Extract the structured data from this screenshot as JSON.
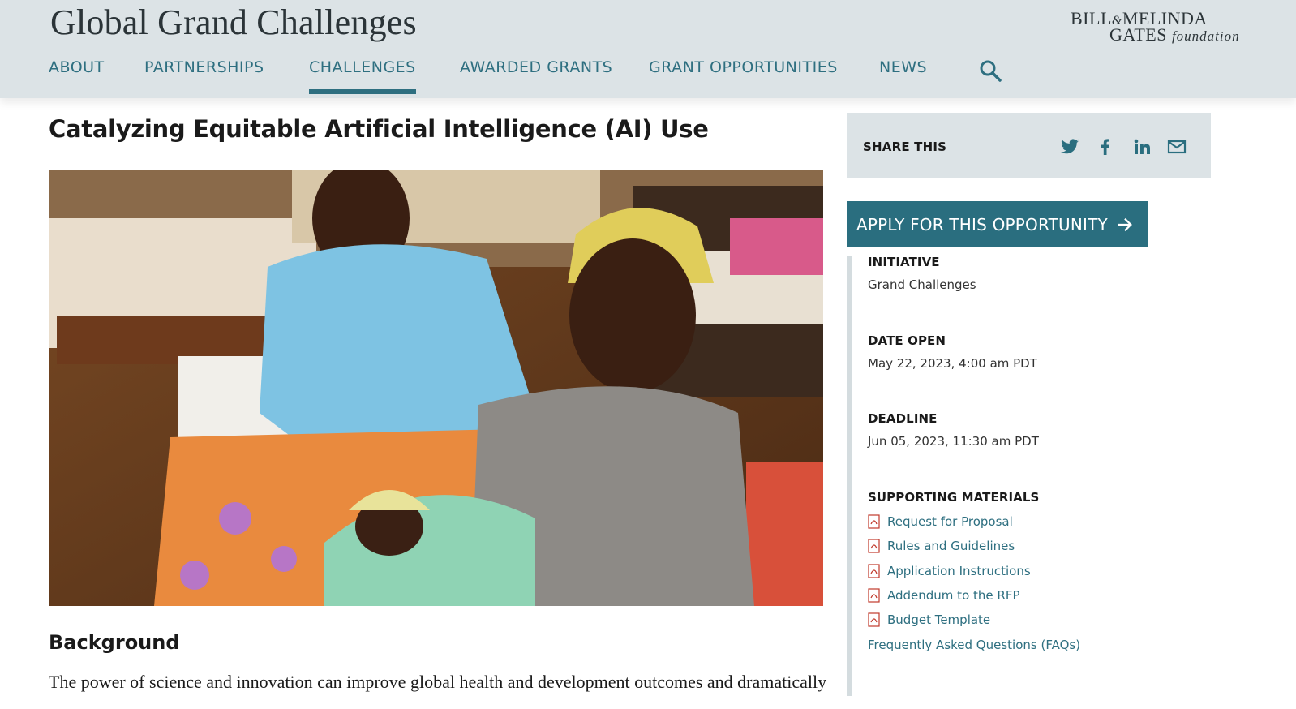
{
  "header": {
    "site_title": "Global Grand Challenges",
    "logo": {
      "line1_a": "BILL",
      "line1_amp": "&",
      "line1_b": "MELINDA",
      "line2": "GATES",
      "line2_suffix": "foundation"
    },
    "nav": [
      {
        "label": "ABOUT",
        "active": false
      },
      {
        "label": "PARTNERSHIPS",
        "active": false
      },
      {
        "label": "CHALLENGES",
        "active": true
      },
      {
        "label": "AWARDED GRANTS",
        "active": false
      },
      {
        "label": "GRANT OPPORTUNITIES",
        "active": false
      },
      {
        "label": "NEWS",
        "active": false
      }
    ],
    "search_icon": "search-icon"
  },
  "main": {
    "title": "Catalyzing Equitable Artificial Intelligence (AI) Use",
    "background_heading": "Background",
    "body_first_line": "The power of science and innovation can improve global health and development outcomes and dramatically"
  },
  "sidebar": {
    "share_label": "SHARE THIS",
    "share_icons": [
      "twitter-icon",
      "facebook-icon",
      "linkedin-icon",
      "email-icon"
    ],
    "apply_label": "APPLY FOR THIS OPPORTUNITY",
    "initiative": {
      "label": "INITIATIVE",
      "value": "Grand Challenges"
    },
    "date_open": {
      "label": "DATE OPEN",
      "value": "May 22, 2023, 4:00 am PDT"
    },
    "deadline": {
      "label": "DEADLINE",
      "value": "Jun 05, 2023, 11:30 am PDT"
    },
    "materials": {
      "label": "SUPPORTING MATERIALS",
      "links": [
        {
          "label": "Request for Proposal",
          "pdf": true
        },
        {
          "label": "Rules and Guidelines",
          "pdf": true
        },
        {
          "label": "Application Instructions",
          "pdf": true
        },
        {
          "label": "Addendum to the RFP",
          "pdf": true
        },
        {
          "label": "Budget Template",
          "pdf": true
        },
        {
          "label": "Frequently Asked Questions (FAQs)",
          "pdf": false
        }
      ]
    }
  },
  "colors": {
    "accent": "#2a6e7f",
    "nav_text": "#2e6f80",
    "header_bg": "#dce3e6"
  }
}
